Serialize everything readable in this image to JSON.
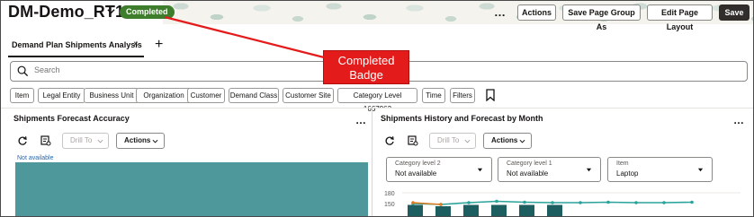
{
  "header": {
    "title": "DM-Demo_RT1",
    "status_badge": "Completed",
    "more": "…",
    "buttons": {
      "actions": "Actions",
      "save_page_group_as": "Save Page Group As",
      "edit_page_layout": "Edit Page Layout",
      "save": "Save"
    }
  },
  "tabs": {
    "active": "Demand Plan Shipments Analysis",
    "close": "×",
    "add": "+"
  },
  "search": {
    "placeholder": "Search"
  },
  "filter_chips": [
    "Item",
    "Legal Entity",
    "Business Unit",
    "Organization",
    "Customer",
    "Demand Class",
    "Customer Site",
    "Category Level 1667963",
    "Time",
    "Filters"
  ],
  "left_panel": {
    "title": "Shipments Forecast Accuracy",
    "more": "…",
    "drill_to": "Drill To",
    "actions": "Actions",
    "not_available": "Not available"
  },
  "right_panel": {
    "title": "Shipments History and Forecast by Month",
    "more": "…",
    "drill_to": "Drill To",
    "actions": "Actions",
    "selects": [
      {
        "label": "Category level 2",
        "value": "Not available"
      },
      {
        "label": "Category level 1",
        "value": "Not available"
      },
      {
        "label": "Item",
        "value": "Laptop"
      }
    ]
  },
  "callout": {
    "line1": "Completed",
    "line2": "Badge"
  },
  "colors": {
    "badge": "#3e7d2c",
    "callout": "#e41b1b",
    "teal": "#4e989c",
    "bar": "#1d5e61",
    "forecast_line": "#2aa39a",
    "history_line": "#e07b1f"
  },
  "chart_data": {
    "type": "bar",
    "y_ticks": [
      "180",
      "150"
    ],
    "ylim": [
      130,
      180
    ],
    "bars": [
      145,
      140,
      145,
      145,
      145,
      145
    ],
    "forecast_line": [
      150,
      148,
      152,
      155,
      153,
      152,
      152,
      153,
      152,
      152,
      153
    ],
    "history_line": [
      152,
      148
    ]
  }
}
